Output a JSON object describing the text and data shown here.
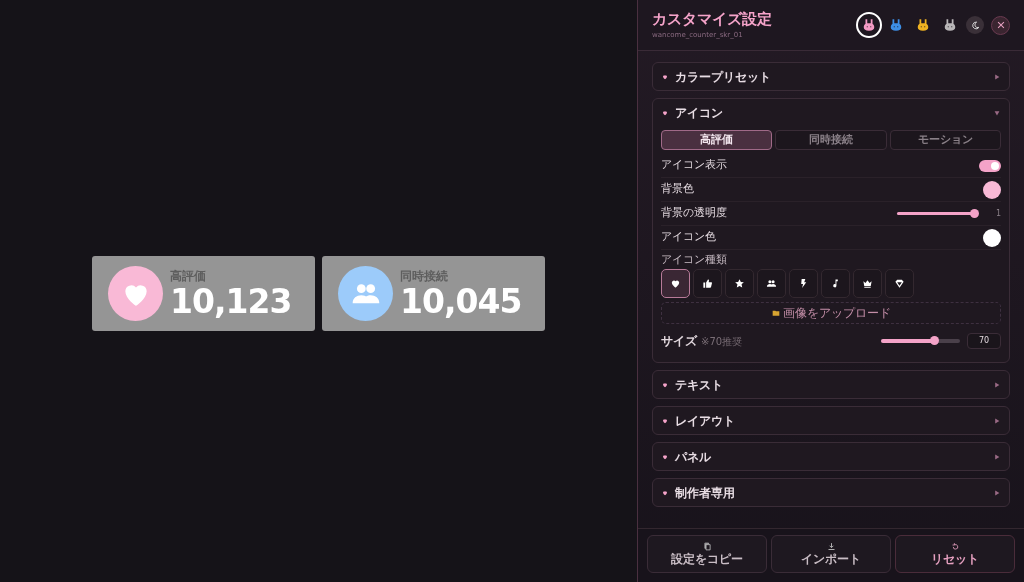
{
  "counters": [
    {
      "kind": "heart",
      "color": "#f9b9d6",
      "label": "高評価",
      "value": "10,123"
    },
    {
      "kind": "people",
      "color": "#9ccbfa",
      "label": "同時接続",
      "value": "10,045"
    }
  ],
  "panel": {
    "title": "カスタマイズ設定",
    "subtitle": "wancome_counter_skr_01",
    "themes": [
      {
        "color": "#f49ac4",
        "selected": true
      },
      {
        "color": "#3d8fe6",
        "selected": false
      },
      {
        "color": "#f0b321",
        "selected": false
      },
      {
        "color": "#b9b6b8",
        "selected": false
      }
    ],
    "sections": [
      {
        "label": "カラープリセット",
        "expanded": false
      },
      {
        "label": "アイコン",
        "expanded": true,
        "tabs": [
          {
            "label": "高評価",
            "selected": true
          },
          {
            "label": "同時接続",
            "selected": false
          },
          {
            "label": "モーション",
            "selected": false
          }
        ],
        "rows": [
          {
            "kind": "toggle",
            "label": "アイコン表示",
            "on": true
          },
          {
            "kind": "color",
            "label": "背景色",
            "color": "#f9b9d6"
          },
          {
            "kind": "slider",
            "label": "背景の透明度",
            "level": 1,
            "reading": "1"
          },
          {
            "kind": "color",
            "label": "アイコン色",
            "color": "#ffffff"
          }
        ],
        "icon_types_label": "アイコン種類",
        "icon_types": [
          {
            "kind": "heart",
            "selected": true
          },
          {
            "kind": "thumb",
            "selected": false
          },
          {
            "kind": "star",
            "selected": false
          },
          {
            "kind": "people",
            "selected": false
          },
          {
            "kind": "bolt",
            "selected": false
          },
          {
            "kind": "note",
            "selected": false
          },
          {
            "kind": "crown",
            "selected": false
          },
          {
            "kind": "gem",
            "selected": false
          }
        ],
        "upload": "画像をアップロード",
        "size": {
          "label": "サイズ",
          "note": "※70推奨",
          "level": 0.68,
          "value": "70"
        }
      },
      {
        "label": "テキスト",
        "expanded": false
      },
      {
        "label": "レイアウト",
        "expanded": false
      },
      {
        "label": "パネル",
        "expanded": false
      },
      {
        "label": "制作者専用",
        "expanded": false
      }
    ],
    "footer": [
      {
        "kind": "copy",
        "label": "設定をコピー"
      },
      {
        "kind": "import",
        "label": "インポート"
      },
      {
        "kind": "reset",
        "label": "リセット"
      }
    ]
  }
}
